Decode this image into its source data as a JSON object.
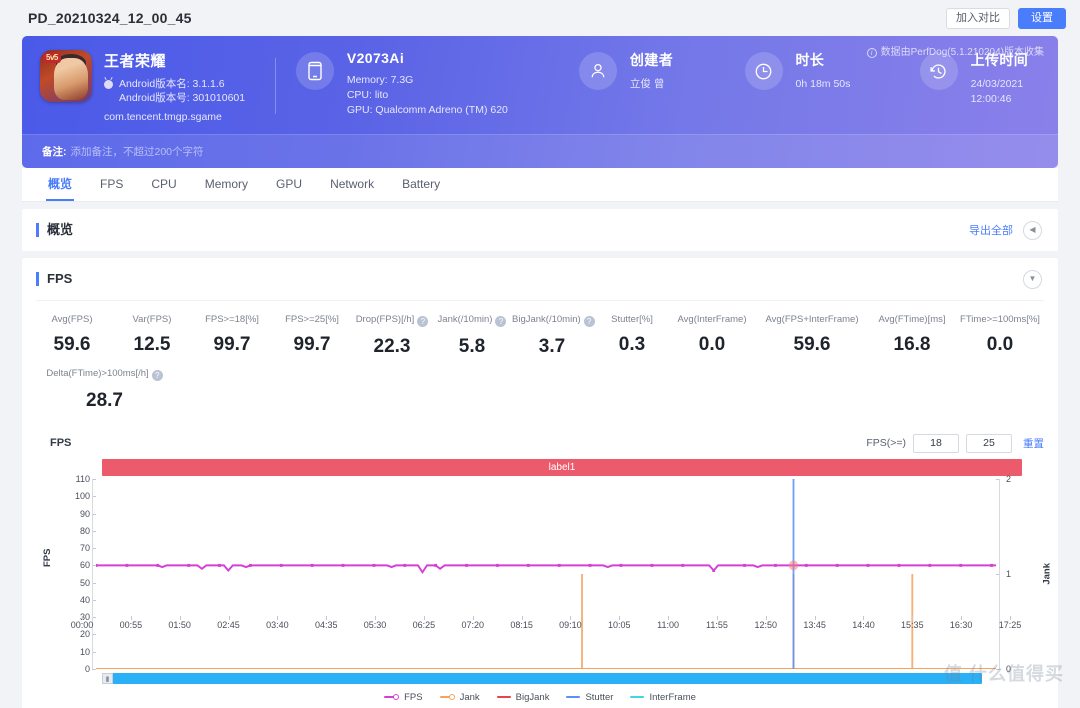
{
  "topbar": {
    "doc_title": "PD_20210324_12_00_45",
    "compare_button": "加入对比",
    "settings_button": "设置"
  },
  "hero": {
    "app": {
      "name": "王者荣耀",
      "version_name": "Android版本名: 3.1.1.6",
      "version_code": "Android版本号: 301010601",
      "package": "com.tencent.tmgp.sgame",
      "icon_badge": "5v5"
    },
    "device": {
      "model": "V2073A",
      "memory": "Memory: 7.3G",
      "cpu": "CPU: lito",
      "gpu": "GPU: Qualcomm Adreno (TM) 620",
      "icon": "phone-icon"
    },
    "creator": {
      "title": "创建者",
      "value": "立俊 曾",
      "icon": "user-icon"
    },
    "duration": {
      "title": "时长",
      "value": "0h 18m 50s",
      "icon": "clock-icon"
    },
    "upload": {
      "title": "上传时间",
      "value": "24/03/2021 12:00:46",
      "icon": "history-icon"
    },
    "perfdog_note": "数据由PerfDog(5.1.210204)版本收集",
    "note_label": "备注:",
    "note_placeholder": "添加备注，不超过200个字符"
  },
  "tabs": [
    {
      "label": "概览",
      "active": true
    },
    {
      "label": "FPS",
      "active": false
    },
    {
      "label": "CPU",
      "active": false
    },
    {
      "label": "Memory",
      "active": false
    },
    {
      "label": "GPU",
      "active": false
    },
    {
      "label": "Network",
      "active": false
    },
    {
      "label": "Battery",
      "active": false
    }
  ],
  "overview_panel": {
    "title": "概览",
    "export_all": "导出全部",
    "collapse_icon": "chevron-left-icon"
  },
  "fps_panel": {
    "title": "FPS",
    "collapse_icon": "chevron-down-icon",
    "metrics": [
      {
        "label": "Avg(FPS)",
        "value": "59.6",
        "help": false
      },
      {
        "label": "Var(FPS)",
        "value": "12.5",
        "help": false
      },
      {
        "label": "FPS>=18[%]",
        "value": "99.7",
        "help": false
      },
      {
        "label": "FPS>=25[%]",
        "value": "99.7",
        "help": false
      },
      {
        "label": "Drop(FPS)[/h]",
        "value": "22.3",
        "help": true
      },
      {
        "label": "Jank(/10min)",
        "value": "5.8",
        "help": true
      },
      {
        "label": "BigJank(/10min)",
        "value": "3.7",
        "help": true
      },
      {
        "label": "Stutter[%]",
        "value": "0.3",
        "help": false
      },
      {
        "label": "Avg(InterFrame)",
        "value": "0.0",
        "help": false
      },
      {
        "label": "Avg(FPS+InterFrame)",
        "value": "59.6",
        "help": false
      },
      {
        "label": "Avg(FTime)[ms]",
        "value": "16.8",
        "help": false
      },
      {
        "label": "FTime>=100ms[%]",
        "value": "0.0",
        "help": false
      }
    ],
    "metrics_second": [
      {
        "label": "Delta(FTime)>100ms[/h]",
        "value": "28.7",
        "help": true
      }
    ],
    "chart_title": "FPS",
    "threshold_label": "FPS(>=)",
    "threshold_low": "18",
    "threshold_high": "25",
    "reset_label": "重置",
    "label_bar": "label1"
  },
  "chart_data": {
    "type": "line",
    "title": "FPS",
    "xlabel": "",
    "ylabel": "FPS",
    "y2label": "Jank",
    "ylim": [
      0,
      110
    ],
    "y2lim": [
      0,
      2
    ],
    "yticks": [
      0,
      10,
      20,
      30,
      40,
      50,
      60,
      70,
      80,
      90,
      100,
      110
    ],
    "y2ticks": [
      0,
      1,
      2
    ],
    "grid": false,
    "legend_position": "bottom",
    "xticks": [
      "00:00",
      "00:55",
      "01:50",
      "02:45",
      "03:40",
      "04:35",
      "05:30",
      "06:25",
      "07:20",
      "08:15",
      "09:10",
      "10:05",
      "11:00",
      "11:55",
      "12:50",
      "13:45",
      "14:40",
      "15:35",
      "16:30",
      "17:25"
    ],
    "series": [
      {
        "name": "FPS",
        "color": "#d63fd6",
        "axis": "left",
        "values": [
          60,
          60,
          60,
          60,
          60,
          60,
          60,
          60,
          60,
          60,
          60,
          60,
          60,
          60,
          60,
          59,
          60,
          60,
          60,
          60,
          60,
          60,
          60,
          60,
          58,
          60,
          60,
          60,
          60,
          60,
          57,
          60,
          60,
          60,
          59,
          60,
          60,
          60,
          60,
          60,
          60,
          60,
          60,
          60,
          60,
          60,
          60,
          60,
          60,
          60,
          60,
          60,
          60,
          60,
          60,
          60,
          60,
          60,
          60,
          60,
          60,
          60,
          60,
          60,
          60,
          60,
          60,
          59,
          60,
          60,
          60,
          60,
          60,
          60,
          56,
          60,
          60,
          60,
          58,
          60,
          60,
          60,
          60,
          60,
          60,
          60,
          60,
          60,
          60,
          60,
          60,
          60,
          60,
          60,
          60,
          60,
          60,
          60,
          60,
          60,
          60,
          60,
          60,
          60,
          60,
          60,
          60,
          60,
          60,
          60,
          60,
          60,
          60,
          60,
          60,
          60,
          59,
          60,
          60,
          60,
          60,
          60,
          60,
          60,
          60,
          60,
          60,
          60,
          60,
          60,
          60,
          60,
          60,
          60,
          60,
          60,
          60,
          60,
          60,
          60,
          57,
          60,
          60,
          60,
          60,
          60,
          60,
          60,
          60,
          60,
          59,
          60,
          60,
          60,
          60,
          60,
          60,
          60,
          60,
          60,
          60,
          60,
          60,
          60,
          60,
          60,
          60,
          60,
          60,
          60,
          60,
          60,
          60,
          60,
          60,
          60,
          60,
          60,
          60,
          60,
          60,
          60,
          60,
          60,
          60,
          60,
          60,
          60,
          60,
          60,
          60,
          60,
          60,
          60,
          60,
          60,
          60,
          60,
          60,
          60,
          60,
          60,
          60,
          60,
          60
        ]
      },
      {
        "name": "Jank",
        "color": "#f5a25d",
        "axis": "right",
        "spikes": [
          {
            "x_pct": 54.0,
            "value": 1
          },
          {
            "x_pct": 77.5,
            "value": 1
          },
          {
            "x_pct": 90.7,
            "value": 1
          }
        ]
      },
      {
        "name": "BigJank",
        "color": "#e8424b",
        "axis": "right",
        "spikes": []
      },
      {
        "name": "Stutter",
        "color": "#5b8ff9",
        "axis": "right",
        "spikes": [
          {
            "x_pct": 77.5,
            "value": 2
          }
        ]
      },
      {
        "name": "InterFrame",
        "color": "#3fd6e0",
        "axis": "right",
        "spikes": []
      }
    ],
    "legend": [
      "FPS",
      "Jank",
      "BigJank",
      "Stutter",
      "InterFrame"
    ]
  },
  "scrollbar": {
    "handle_icon": "drag-handle-icon"
  },
  "watermark": "值 什么值得买"
}
